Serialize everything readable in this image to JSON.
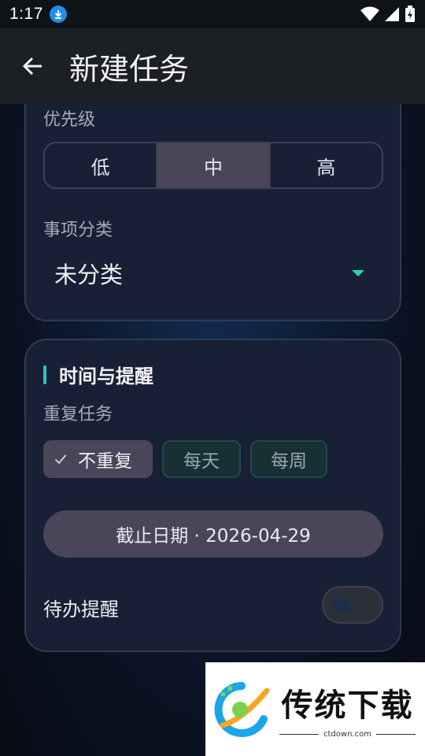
{
  "status_bar": {
    "time": "1:17"
  },
  "app_bar": {
    "title": "新建任务"
  },
  "priority": {
    "label": "优先级",
    "options": [
      "低",
      "中",
      "高"
    ],
    "selected": "中"
  },
  "category": {
    "label": "事项分类",
    "value": "未分类"
  },
  "time_section": {
    "title": "时间与提醒",
    "repeat_label": "重复任务",
    "repeat_options": [
      "不重复",
      "每天",
      "每周"
    ],
    "repeat_selected": "不重复",
    "deadline_text": "截止日期 · 2026-04-29",
    "reminder_label": "待办提醒",
    "reminder_on": false
  },
  "watermark": {
    "name": "传统下载",
    "url": "ctdown.com"
  },
  "colors": {
    "accent": "#2ad0c8",
    "selected": "#4a4558",
    "card": "#172035",
    "appbar": "#1c1f24"
  }
}
